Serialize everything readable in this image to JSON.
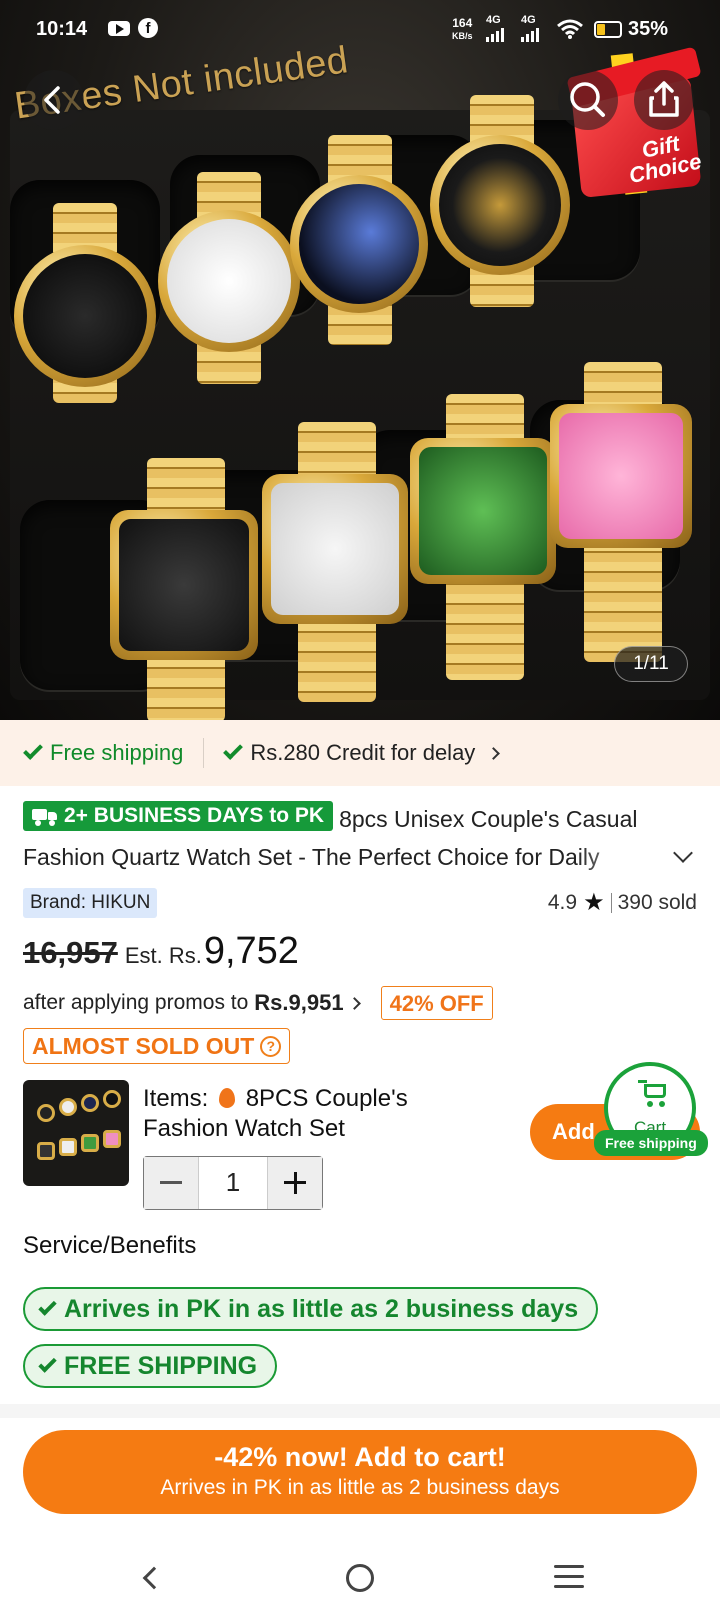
{
  "status_bar": {
    "time": "10:14",
    "speed_value": "164",
    "speed_unit": "KB/s",
    "net1": "4G",
    "net2": "4G",
    "battery": "35%"
  },
  "hero": {
    "overlay_text": "Boxes Not included",
    "gift_label": "Gift Choice",
    "image_counter": "1/11"
  },
  "shipping_strip": {
    "free_shipping": "Free shipping",
    "credit": "Rs.280 Credit for delay"
  },
  "product": {
    "delivery_badge": "2+ BUSINESS DAYS to PK",
    "title": "8pcs Unisex Couple's Casual Fashion Quartz Watch Set - The Perfect Choice for Daily",
    "brand": "Brand: HIKUN",
    "rating": "4.9",
    "sold": "390 sold",
    "old_price": "16,957",
    "est_label": "Est. Rs.",
    "new_price": "9,752",
    "promo_text": "after applying promos to",
    "promo_price": "Rs.9,951",
    "discount_badge": "42% OFF",
    "stock_badge": "ALMOST SOLD OUT"
  },
  "sku": {
    "items_label": "Items:",
    "items_value": "8PCS Couple's Fashion Watch Set",
    "quantity": "1",
    "add_label": "Add",
    "cart_label": "Cart",
    "cart_badge": "Free shipping"
  },
  "service": {
    "title": "Service/Benefits",
    "benefits": [
      "Arrives in PK in as little as 2 business days",
      "FREE SHIPPING"
    ]
  },
  "cta": {
    "line1": "-42% now! Add to cart!",
    "line2": "Arrives in PK in as little as 2 business days"
  },
  "colors": {
    "accent_orange": "#f57b12",
    "success_green": "#1a9a35",
    "shipping_bg": "#fdf1e8"
  },
  "icons": [
    "back-arrow-icon",
    "search-icon",
    "share-icon",
    "check-icon",
    "chevron-right-icon",
    "chevron-down-icon",
    "truck-icon",
    "star-icon",
    "question-icon",
    "fire-icon",
    "minus-icon",
    "plus-icon",
    "cart-icon"
  ]
}
